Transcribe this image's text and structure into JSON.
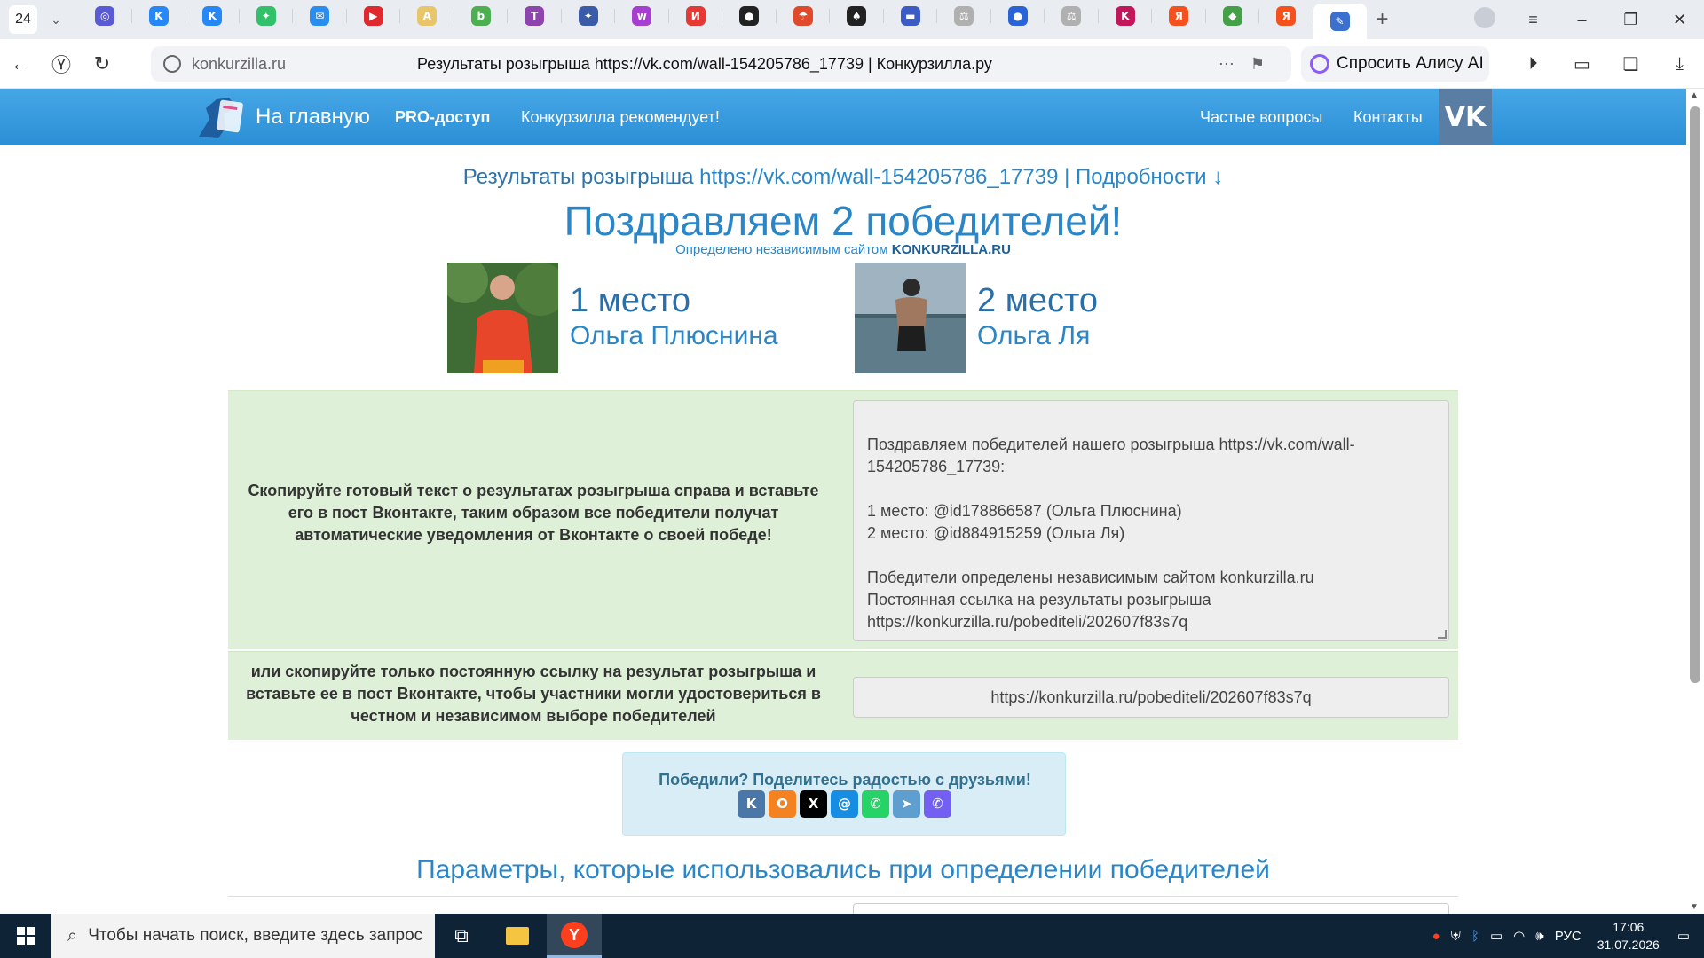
{
  "browser": {
    "tab_count": "24",
    "tabs": [
      {
        "icon": "music-icon",
        "glyph": "◎",
        "color": "#5a5ad6"
      },
      {
        "icon": "vk-icon",
        "glyph": "K",
        "color": "#2787f5"
      },
      {
        "icon": "vk-icon",
        "glyph": "K",
        "color": "#2787f5"
      },
      {
        "icon": "dots-icon",
        "glyph": "✦",
        "color": "#33c06a"
      },
      {
        "icon": "mail-icon",
        "glyph": "✉",
        "color": "#2a8ef0"
      },
      {
        "icon": "youtube-icon",
        "glyph": "▶",
        "color": "#e0282e"
      },
      {
        "icon": "tab-icon",
        "glyph": "A",
        "color": "#e8c46a"
      },
      {
        "icon": "tab-icon",
        "glyph": "b",
        "color": "#4caf50"
      },
      {
        "icon": "tab-icon",
        "glyph": "T",
        "color": "#8e44ad"
      },
      {
        "icon": "star-icon",
        "glyph": "✦",
        "color": "#3a5ca8"
      },
      {
        "icon": "wb-icon",
        "glyph": "w",
        "color": "#a63fcf"
      },
      {
        "icon": "tab-icon",
        "glyph": "И",
        "color": "#e53935"
      },
      {
        "icon": "tab-icon",
        "glyph": "●",
        "color": "#222222"
      },
      {
        "icon": "umbrella-icon",
        "glyph": "☂",
        "color": "#e04a2a"
      },
      {
        "icon": "spade-icon",
        "glyph": "♠",
        "color": "#222222"
      },
      {
        "icon": "flag-icon",
        "glyph": "▬",
        "color": "#3b5cc4"
      },
      {
        "icon": "scales-icon",
        "glyph": "⚖",
        "color": "#b0b0b0"
      },
      {
        "icon": "chat-icon",
        "glyph": "●",
        "color": "#2a62d8"
      },
      {
        "icon": "scales-icon",
        "glyph": "⚖",
        "color": "#b0b0b0"
      },
      {
        "icon": "tab-icon",
        "glyph": "K",
        "color": "#c2185b"
      },
      {
        "icon": "yandex-icon",
        "glyph": "Я",
        "color": "#f4511e"
      },
      {
        "icon": "tab-icon",
        "glyph": "◆",
        "color": "#43a047"
      },
      {
        "icon": "yandex-icon",
        "glyph": "Я",
        "color": "#f4511e"
      }
    ],
    "active_tab": {
      "icon": "konkurzilla-icon",
      "glyph": "✎",
      "color": "#3b6fd0"
    },
    "url_host": "konkurzilla.ru",
    "page_title": "Результаты розыгрыша https://vk.com/wall-154205786_17739 | Конкурзилла.ру",
    "alice_label": "Спросить Алису AI"
  },
  "site_nav": {
    "home": "На главную",
    "pro": "PRO-доступ",
    "recommends": "Конкурзилла рекомендует!",
    "faq": "Частые вопросы",
    "contacts": "Контакты",
    "vk": "VK"
  },
  "results": {
    "prefix": "Результаты розыгрыша",
    "link": "https://vk.com/wall-154205786_17739",
    "separator": "|",
    "details": "Подробности ↓",
    "congrats": "Поздравляем 2 победителей!",
    "determined_prefix": "Определено независимым сайтом",
    "determined_site": "KONKURZILLA.RU"
  },
  "winners": [
    {
      "place": "1 место",
      "name": "Ольга Плюснина"
    },
    {
      "place": "2 место",
      "name": "Ольга Ля"
    }
  ],
  "copy_panel": {
    "instruction": "Скопируйте готовый текст о результатах розыгрыша справа и вставьте его в пост Вконтакте, таким образом все победители получат автоматические уведомления от Вконтакте о своей победе!",
    "text": "Поздравляем победителей нашего розыгрыша https://vk.com/wall-154205786_17739:\n\n1 место: @id178866587 (Ольга Плюснина)\n2 место: @id884915259 (Ольга Ля)\n\nПобедители определены независимым сайтом konkurzilla.ru\nПостоянная ссылка на результаты розыгрыша\nhttps://konkurzilla.ru/pobediteli/202607f83s7q"
  },
  "link_panel": {
    "instruction": "или скопируйте только постоянную ссылку на результат розыгрыша и вставьте ее в пост Вконтакте, чтобы участники могли удостовериться в честном и независимом выборе победителей",
    "link": "https://konkurzilla.ru/pobediteli/202607f83s7q"
  },
  "share": {
    "title": "Победили? Поделитесь радостью с друзьями!",
    "buttons": [
      {
        "name": "vk-share-icon",
        "glyph": "K",
        "color": "#4a76a8"
      },
      {
        "name": "ok-share-icon",
        "glyph": "O",
        "color": "#f58220"
      },
      {
        "name": "x-share-icon",
        "glyph": "X",
        "color": "#000000"
      },
      {
        "name": "mailru-share-icon",
        "glyph": "@",
        "color": "#168de2"
      },
      {
        "name": "whatsapp-share-icon",
        "glyph": "✆",
        "color": "#25d366"
      },
      {
        "name": "telegram-share-icon",
        "glyph": "➤",
        "color": "#5e9fcf"
      },
      {
        "name": "viber-share-icon",
        "glyph": "✆",
        "color": "#7360f2"
      }
    ]
  },
  "params_title": "Параметры, которые использовались при определении победителей",
  "taskbar": {
    "search_placeholder": "Чтобы начать поиск, введите здесь запрос",
    "lang": "РУС",
    "time": "17:06",
    "date": "31.07.2026"
  },
  "colors": {
    "nav_blue": "#2b8fd6",
    "link_blue": "#2a86c7",
    "panel_green": "#dff0d8",
    "share_blue": "#d9edf7"
  }
}
